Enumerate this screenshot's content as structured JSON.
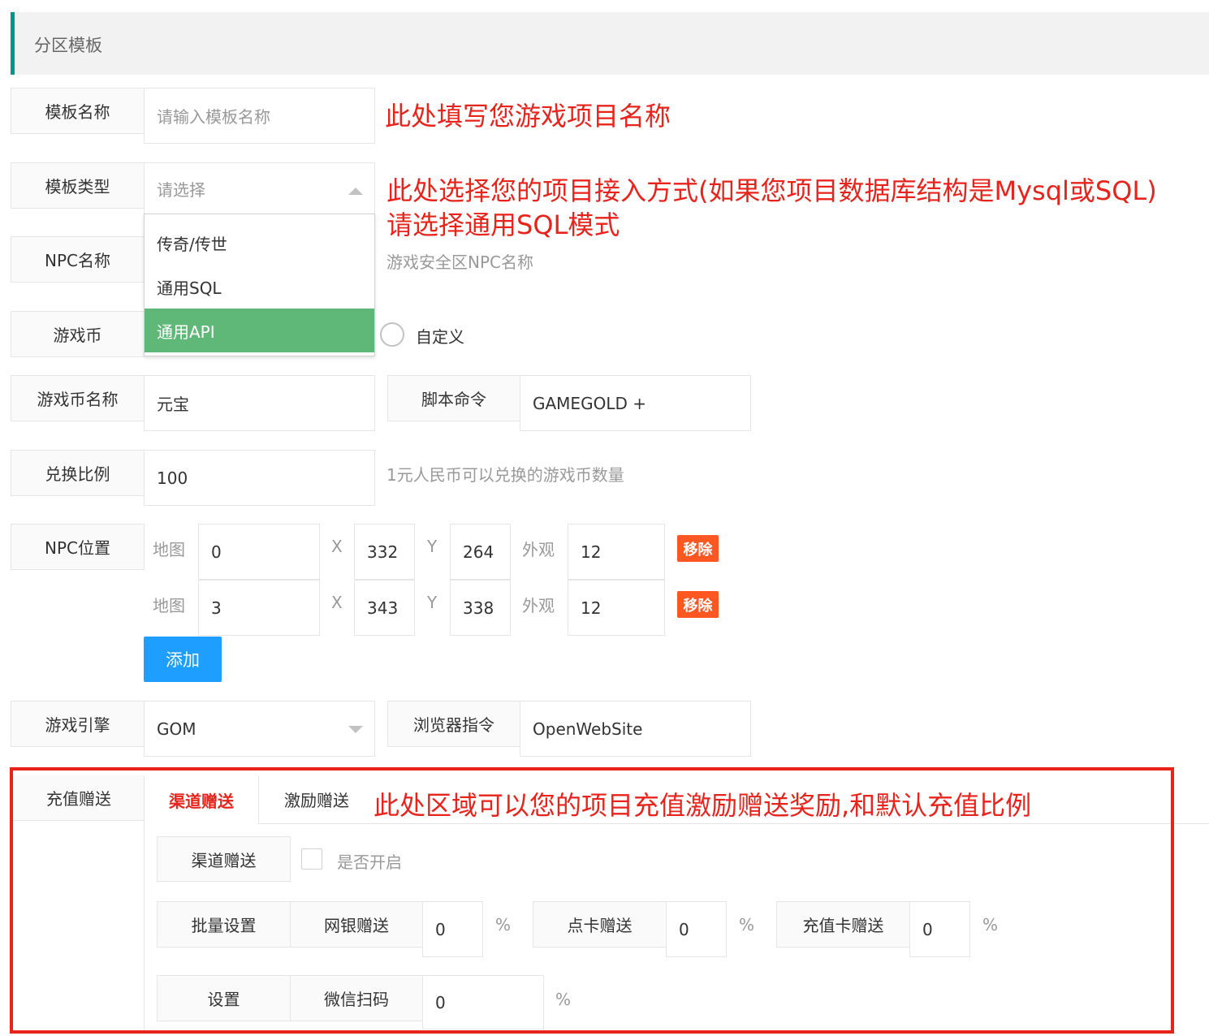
{
  "header": {
    "title": "分区模板"
  },
  "template_name": {
    "label": "模板名称",
    "placeholder": "请输入模板名称",
    "note": "此处填写您游戏项目名称"
  },
  "template_type": {
    "label": "模板类型",
    "placeholder": "请选择",
    "note_line1": "此处选择您的项目接入方式(如果您项目数据库结构是Mysql或SQL)",
    "note_line2": "请选择通用SQL模式",
    "options": [
      "传奇/传世",
      "通用SQL",
      "通用API"
    ],
    "selected_option": "通用API"
  },
  "npc_name": {
    "label": "NPC名称",
    "hint": "游戏安全区NPC名称"
  },
  "game_currency": {
    "label": "游戏币",
    "radio_custom_label": "自定义"
  },
  "currency_name": {
    "label": "游戏币名称",
    "value": "元宝",
    "script_label": "脚本命令",
    "script_value": "GAMEGOLD +"
  },
  "exchange_ratio": {
    "label": "兑换比例",
    "value": "100",
    "hint": "1元人民币可以兑换的游戏币数量"
  },
  "npc_position": {
    "label": "NPC位置",
    "map_label": "地图",
    "x_label": "X",
    "y_label": "Y",
    "look_label": "外观",
    "remove_label": "移除",
    "add_label": "添加",
    "rows": [
      {
        "map": "0",
        "x": "332",
        "y": "264",
        "look": "12"
      },
      {
        "map": "3",
        "x": "343",
        "y": "338",
        "look": "12"
      }
    ]
  },
  "game_engine": {
    "label": "游戏引擎",
    "value": "GOM",
    "browser_label": "浏览器指令",
    "browser_value": "OpenWebSite"
  },
  "recharge_gift": {
    "label": "充值赠送",
    "tabs": [
      "渠道赠送",
      "激励赠送"
    ],
    "note": "此处区域可以您的项目充值激励赠送奖励,和默认充值比例",
    "channel_gift_label": "渠道赠送",
    "enable_label": "是否开启",
    "batch_label": "批量设置",
    "bank_label": "网银赠送",
    "bank_value": "0",
    "card_label": "点卡赠送",
    "card_value": "0",
    "rechargecard_label": "充值卡赠送",
    "rechargecard_value": "0",
    "set_label": "设置",
    "wechat_label": "微信扫码",
    "wechat_value": "0",
    "percent": "%"
  },
  "colors": {
    "accent": "#009688",
    "selected": "#5fb878",
    "danger": "#ff5722",
    "primary": "#1e9fff",
    "annotation": "#e8231c"
  }
}
